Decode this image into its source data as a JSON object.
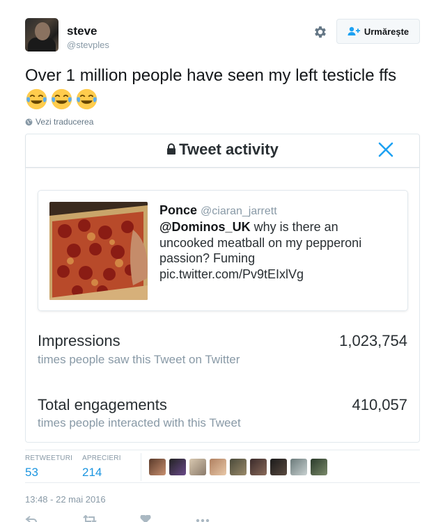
{
  "user": {
    "display_name": "steve",
    "handle": "@stevples",
    "follow_label": "Urmărește"
  },
  "tweet": {
    "text": "Over 1 million people have seen my left testicle ffs",
    "emojis": [
      "face-with-tears-of-joy",
      "face-with-tears-of-joy",
      "face-with-tears-of-joy"
    ],
    "translate_label": "Vezi traducerea"
  },
  "activity_card": {
    "title": "Tweet activity",
    "embedded_tweet": {
      "name": "Ponce",
      "handle": "@ciaran_jarrett",
      "mention": "@Dominos_UK",
      "text": " why is there an uncooked meatball on my pepperoni passion? Fuming pic.twitter.com/Pv9tEIxlVg"
    },
    "metrics": [
      {
        "label": "Impressions",
        "sub": "times people saw this Tweet on Twitter",
        "value": "1,023,754"
      },
      {
        "label": "Total engagements",
        "sub": "times people interacted with this Tweet",
        "value": "410,057"
      }
    ]
  },
  "stats": {
    "retweets_label": "RETWEETURI",
    "retweets": "53",
    "likes_label": "APRECIERI",
    "likes": "214"
  },
  "timestamp": "13:48 - 22 mai 2016",
  "colors": {
    "accent": "#1b95e0",
    "close_x": "#1da1f2",
    "muted": "#8899a6"
  },
  "icons": [
    "gear-icon",
    "follow-person-plus-icon",
    "globe-icon",
    "lock-icon",
    "close-icon",
    "reply-icon",
    "retweet-icon",
    "like-icon",
    "more-icon"
  ]
}
